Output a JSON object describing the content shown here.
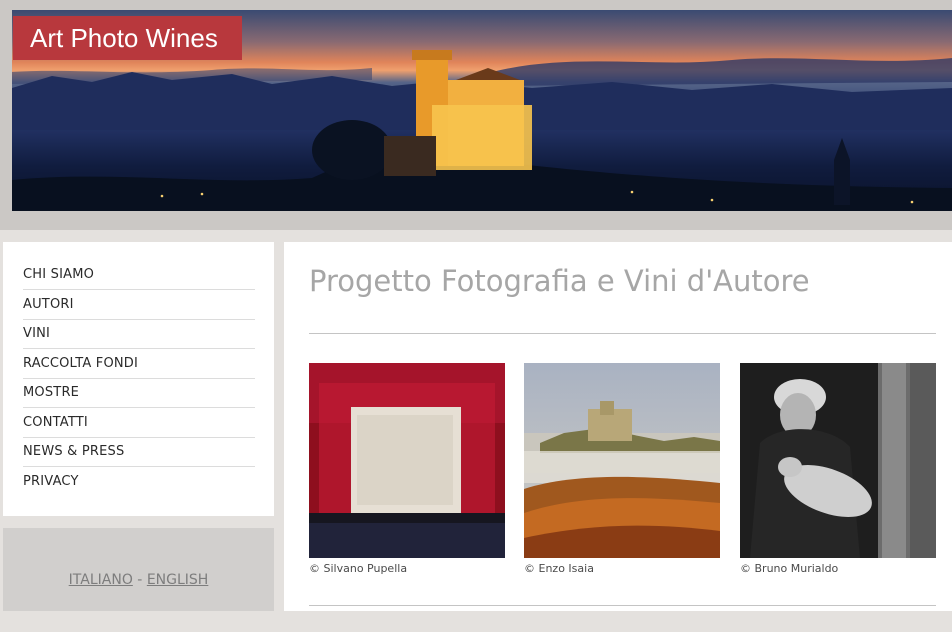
{
  "header": {
    "logo_text": "Art Photo Wines"
  },
  "sidebar": {
    "items": [
      {
        "label": "CHI SIAMO"
      },
      {
        "label": "AUTORI"
      },
      {
        "label": "VINI"
      },
      {
        "label": "RACCOLTA FONDI"
      },
      {
        "label": "MOSTRE"
      },
      {
        "label": "CONTATTI"
      },
      {
        "label": "NEWS & PRESS"
      },
      {
        "label": "PRIVACY"
      }
    ]
  },
  "languages": {
    "italiano": "ITALIANO",
    "separator": "-",
    "english": "ENGLISH"
  },
  "main": {
    "title": "Progetto Fotografia e Vini d'Autore",
    "photos": [
      {
        "caption": "© Silvano Pupella",
        "icon": "abstract-red-square-photo"
      },
      {
        "caption": "© Enzo Isaia",
        "icon": "castle-vineyard-landscape-photo"
      },
      {
        "caption": "© Bruno Murialdo",
        "icon": "woman-with-lamb-bw-photo"
      }
    ]
  },
  "colors": {
    "logo_bg": "#b8383d",
    "title_text": "#a6a6a6",
    "frame_bg": "#cbc8c5",
    "lang_box_bg": "#d1cfcd"
  }
}
